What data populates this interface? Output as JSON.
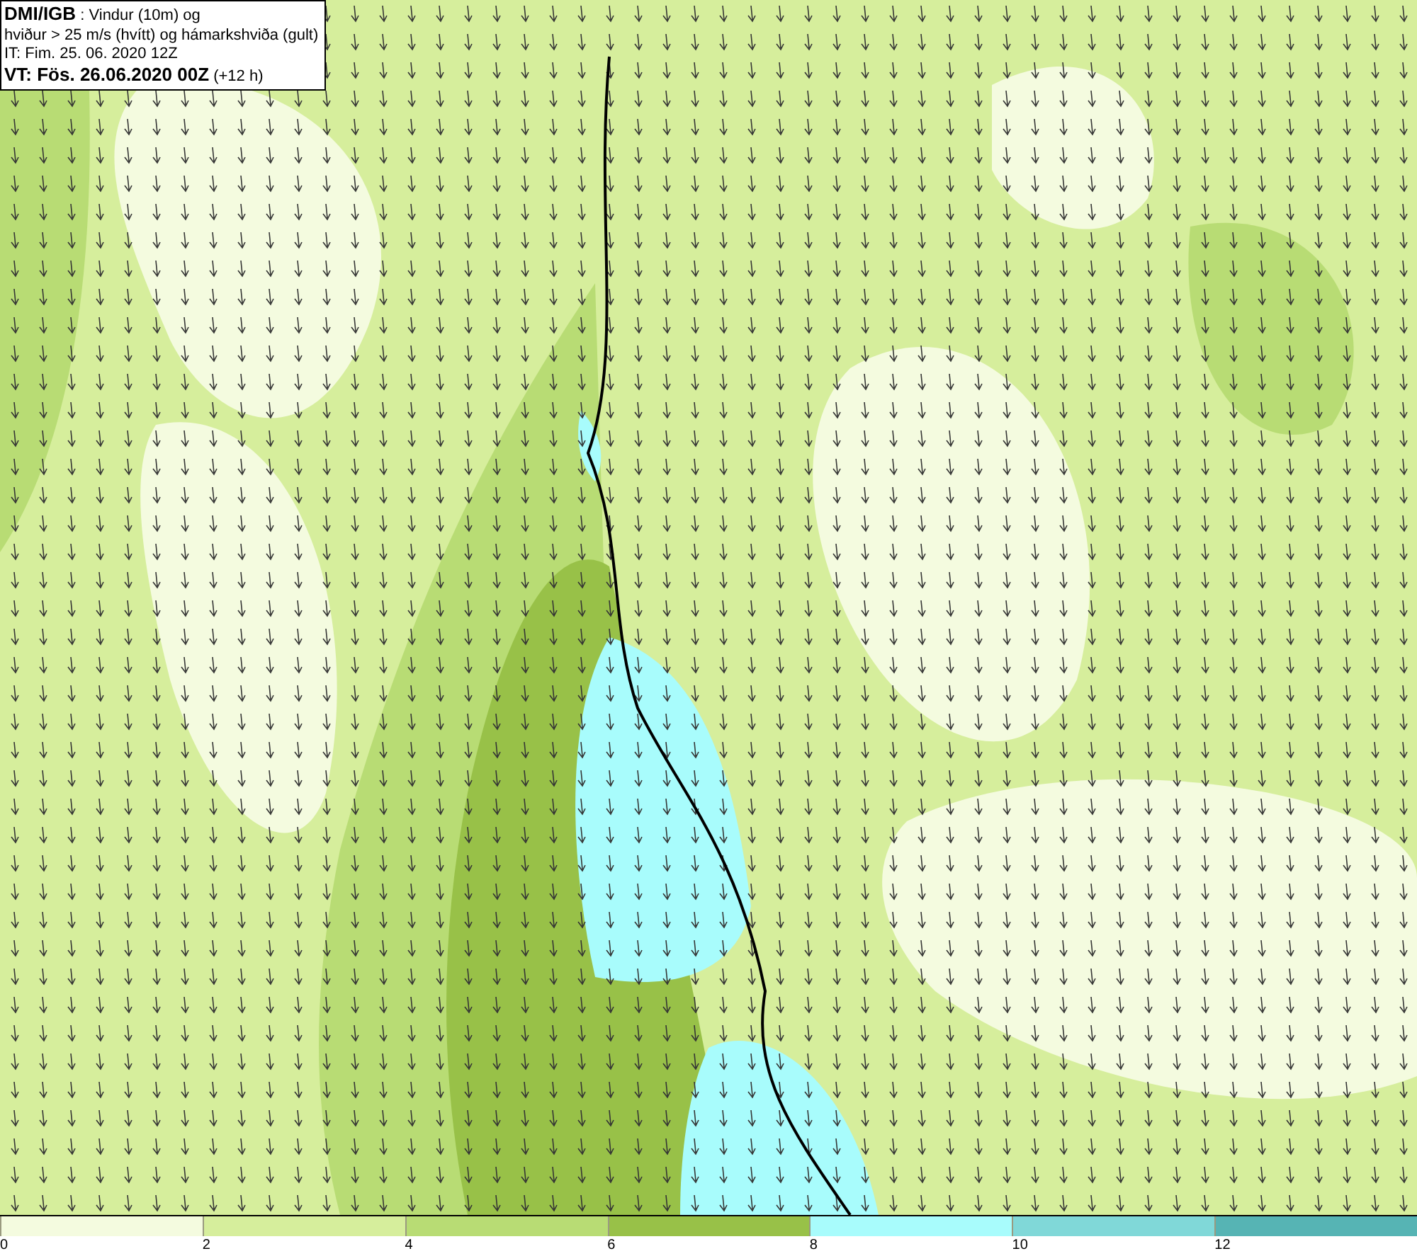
{
  "info_box": {
    "lines": [
      "**DMI/IGB** : Vindur (10m) og",
      "hviður > 25 m/s (hvítt) og hámarkshviða (gult)",
      "IT: Fim. 25. 06. 2020 12Z",
      "**VT: Fös. 26.06.2020 00Z** (+12 h)"
    ]
  },
  "legend": {
    "bins": [
      {
        "color": "#f4fbdf",
        "label": "0"
      },
      {
        "color": "#d6ee9c",
        "label": "2"
      },
      {
        "color": "#b8dc74",
        "label": "4"
      },
      {
        "color": "#98c148",
        "label": "6"
      },
      {
        "color": "#a8fcfc",
        "label": "8"
      },
      {
        "color": "#80d8d8",
        "label": "10"
      },
      {
        "color": "#56b4b4",
        "label": "12"
      }
    ]
  }
}
